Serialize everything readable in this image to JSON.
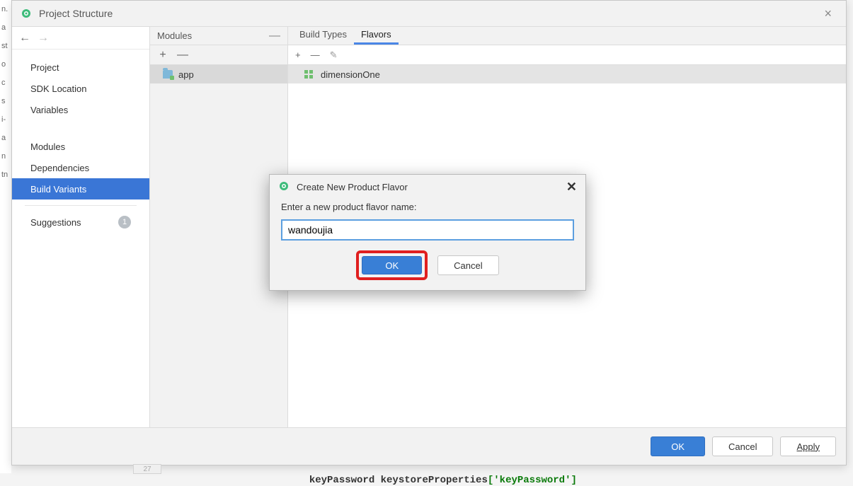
{
  "window": {
    "title": "Project Structure",
    "close_icon": "×"
  },
  "sidebar": {
    "items": [
      {
        "label": "Project"
      },
      {
        "label": "SDK Location"
      },
      {
        "label": "Variables"
      },
      {
        "label": "Modules"
      },
      {
        "label": "Dependencies"
      },
      {
        "label": "Build Variants"
      },
      {
        "label": "Suggestions",
        "badge": "1"
      }
    ]
  },
  "modules": {
    "header": "Modules",
    "items": [
      "app"
    ]
  },
  "tabs": {
    "items": [
      "Build Types",
      "Flavors"
    ],
    "active": "Flavors"
  },
  "flavors": {
    "items": [
      "dimensionOne"
    ]
  },
  "footer": {
    "ok": "OK",
    "cancel": "Cancel",
    "apply": "Apply"
  },
  "dialog": {
    "title": "Create New Product Flavor",
    "label": "Enter a new product flavor name:",
    "value": "wandoujia",
    "ok": "OK",
    "cancel": "Cancel"
  },
  "background_code": {
    "gutter": "27",
    "line_prefix": "keyPassword keystoreProperties",
    "bracket_open": "[",
    "string": "'keyPassword'",
    "bracket_close": "]"
  },
  "left_edge_chars": [
    "n.",
    "a",
    "st",
    "o",
    "c",
    "s",
    "i-",
    "",
    "a",
    "",
    "n",
    "",
    "tn"
  ]
}
